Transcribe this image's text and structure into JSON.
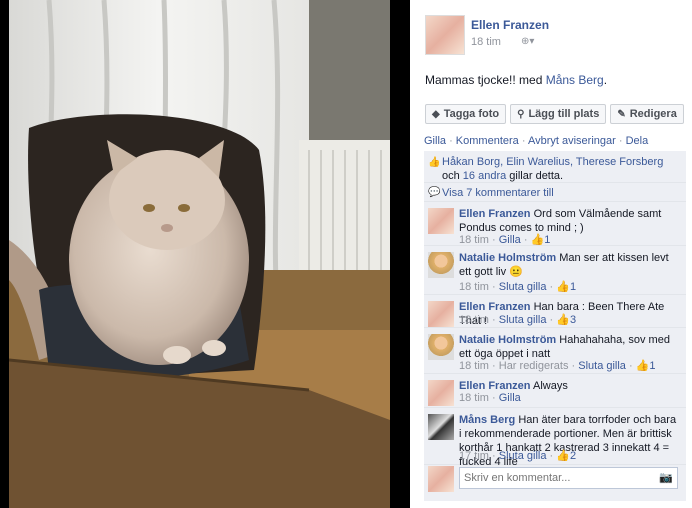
{
  "post": {
    "author": "Ellen Franzen",
    "time": "18 tim",
    "caption_text": "Mammas tjocke!! med ",
    "tagged": "Måns Berg",
    "caption_end": ".",
    "buttons": {
      "tag": "Tagga foto",
      "place": "Lägg till plats",
      "edit": "Redigera"
    },
    "links": {
      "like": "Gilla",
      "comment": "Kommentera",
      "unfollow": "Avbryt aviseringar",
      "share": "Dela"
    }
  },
  "likes": {
    "names": "Håkan Borg, Elin Warelius, Therese Forsberg",
    "och": " och ",
    "others": "16 andra",
    "suffix": " gillar detta."
  },
  "more_comments": "Visa 7 kommentarer till",
  "comments": [
    {
      "author": "Ellen Franzen",
      "text": "Ord som Välmående samt Pondus comes to mind ; )",
      "time": "18 tim",
      "action": "Gilla",
      "likes": "1"
    },
    {
      "author": "Natalie Holmström",
      "text": "Man ser att kissen levt ett gott liv",
      "emoji": "😐",
      "time": "18 tim",
      "action": "Sluta gilla",
      "likes": "1"
    },
    {
      "author": "Ellen Franzen",
      "text": "Han bara : Been There Ate That !",
      "time": "18 tim",
      "action": "Sluta gilla",
      "likes": "3"
    },
    {
      "author": "Natalie Holmström",
      "text": "Hahahahaha, sov med ett öga öppet i natt",
      "time": "18 tim",
      "edited": "Har redigerats",
      "action": "Sluta gilla",
      "likes": "1"
    },
    {
      "author": "Ellen Franzen",
      "text": "Always",
      "time": "18 tim",
      "action": "Gilla"
    },
    {
      "author": "Måns Berg",
      "text": "Han äter bara torrfoder och bara i rekommenderade portioner. Men är brittisk korthår 1 hankatt 2 kastrerad 3 innekatt 4 = fucked 4 life",
      "time": "17 tim",
      "action": "Sluta gilla",
      "likes": "2"
    }
  ],
  "reply": {
    "placeholder": "Skriv en kommentar..."
  },
  "icons": {
    "tag": "tag-icon",
    "place": "map-pin-icon",
    "edit": "pencil-icon",
    "like": "thumbs-up-icon",
    "comment": "speech-bubble-icon",
    "camera": "camera-icon",
    "privacy": "globe-icon"
  }
}
